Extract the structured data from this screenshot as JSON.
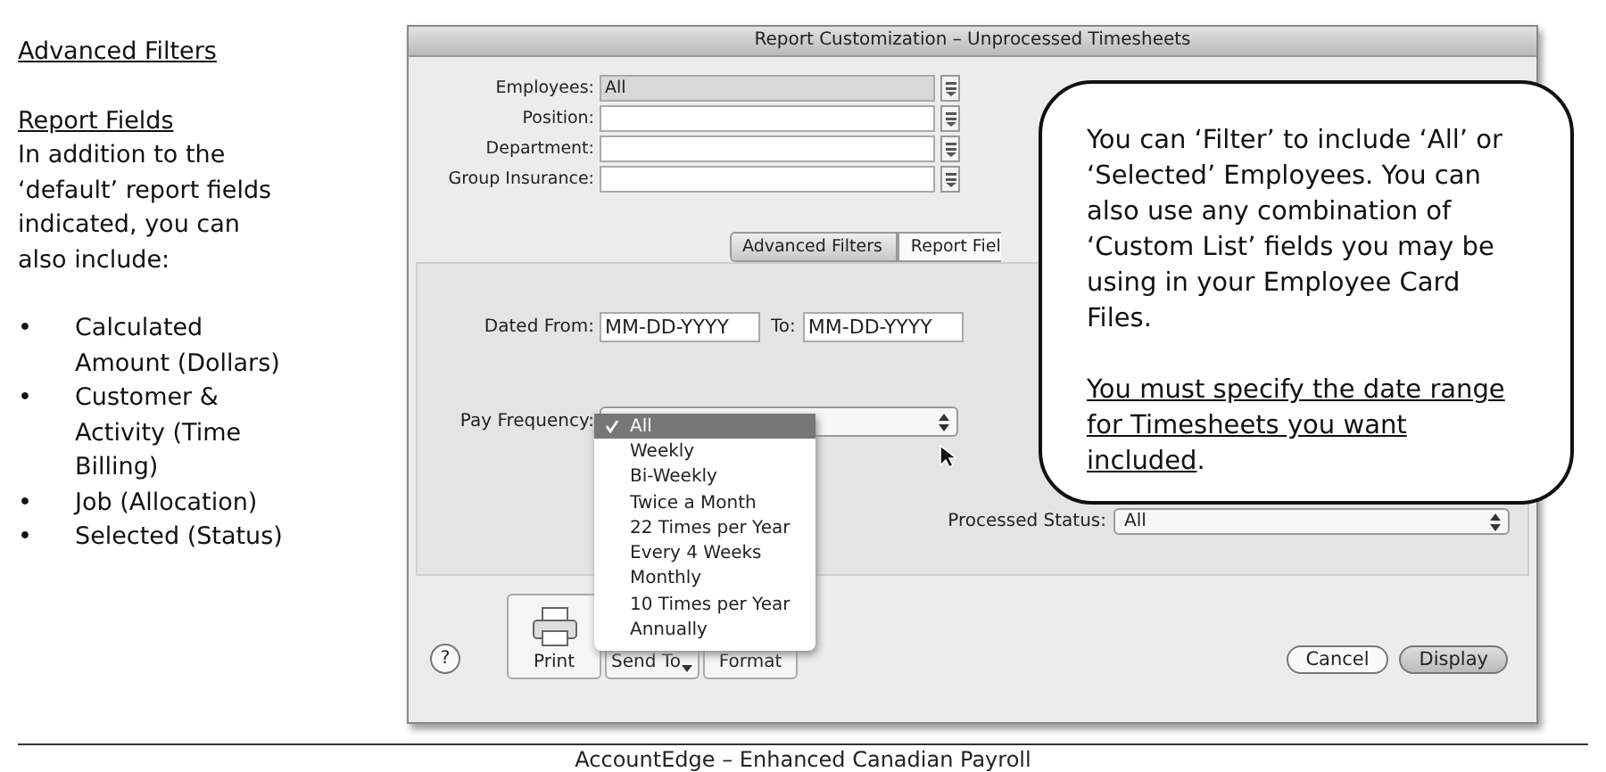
{
  "notes": {
    "heading": "Advanced Filters",
    "subheading": "Report Fields",
    "intro": "In addition to the ‘default’ report fields indicated, you can also include:",
    "items": [
      {
        "bullet": "•",
        "text": "Calculated Amount (Dollars)"
      },
      {
        "bullet": "•",
        "text": "Customer & Activity (Time Billing)"
      },
      {
        "bullet": "•",
        "text": "Job (Allocation)"
      },
      {
        "bullet": "•",
        "text": "Selected (Status)"
      }
    ]
  },
  "window": {
    "title": "Report Customization – Unprocessed Timesheets",
    "filters": [
      {
        "label": "Employees:",
        "value": "All"
      },
      {
        "label": "Position:"
      },
      {
        "label": "Department:"
      },
      {
        "label": "Group Insurance:"
      }
    ],
    "tabs": [
      {
        "label": "Advanced Filters",
        "selected": true
      },
      {
        "label": "Report Fiel",
        "selected": false
      }
    ],
    "date_range": {
      "from_label": "Dated From:",
      "from_value": "MM-DD-YYYY",
      "to_label": "To:",
      "to_value": "MM-DD-YYYY"
    },
    "pay_frequency": {
      "label": "Pay Frequency:",
      "menu": [
        {
          "label": "All",
          "selected": true
        },
        {
          "label": "Weekly",
          "selected": false
        },
        {
          "label": "Bi-Weekly",
          "selected": false
        },
        {
          "label": "Twice a Month",
          "selected": false
        },
        {
          "label": "22 Times per Year",
          "selected": false
        },
        {
          "label": "Every 4 Weeks",
          "selected": false
        },
        {
          "label": "Monthly",
          "selected": false
        },
        {
          "label": "10 Times per Year",
          "selected": false
        },
        {
          "label": "Annually",
          "selected": false
        }
      ]
    },
    "processed_status": {
      "label": "Processed Status:",
      "value": "All"
    },
    "help": "?",
    "toolbar": [
      {
        "label": "Print",
        "kind": "print"
      },
      {
        "label": "Send To",
        "kind": "send"
      },
      {
        "label": "Format",
        "kind": "format"
      }
    ],
    "buttons": [
      {
        "label": "Cancel",
        "default": false
      },
      {
        "label": "Display",
        "default": true
      }
    ]
  },
  "callout": {
    "text": "You can ‘Filter’ to include ‘All’ or ‘Selected’ Employees. You can also use any combination of ‘Custom List’ fields you may be using in your Employee Card Files.",
    "underlined": "You must specify the date range for Timesheets you want included",
    "end": "."
  },
  "footer": "AccountEdge – Enhanced Canadian Payroll"
}
